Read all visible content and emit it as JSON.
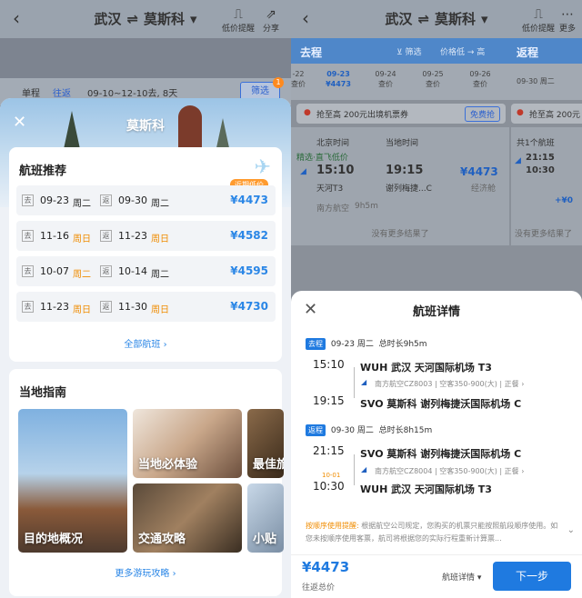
{
  "left": {
    "route": {
      "from": "武汉",
      "arrow": "⇌",
      "to": "莫斯科",
      "dropdown": "▾"
    },
    "actions": [
      {
        "icon": "price-alert-icon",
        "label": "低价提醒"
      },
      {
        "icon": "share-icon",
        "label": "分享"
      }
    ],
    "filter": {
      "one_way": "单程",
      "round_trip": "往返",
      "dates": "09-10~12-10去, 8天",
      "filter_btn": "筛选",
      "badge": "1"
    },
    "sheet": {
      "title": "莫斯科",
      "rec_title": "航班推荐",
      "low_tag": "近期低价",
      "go_tag": "去",
      "ret_tag": "返",
      "flights": [
        {
          "go_date": "09-23",
          "go_wd": "周二",
          "go_we": false,
          "ret_date": "09-30",
          "ret_wd": "周二",
          "ret_we": false,
          "price": "¥4473"
        },
        {
          "go_date": "11-16",
          "go_wd": "周日",
          "go_we": true,
          "ret_date": "11-23",
          "ret_wd": "周日",
          "ret_we": true,
          "price": "¥4582"
        },
        {
          "go_date": "10-07",
          "go_wd": "周二",
          "go_we": true,
          "ret_date": "10-14",
          "ret_wd": "周二",
          "ret_we": false,
          "price": "¥4595"
        },
        {
          "go_date": "11-23",
          "go_wd": "周日",
          "go_we": true,
          "ret_date": "11-30",
          "ret_wd": "周日",
          "ret_we": true,
          "price": "¥4730"
        }
      ],
      "all_flights": "全部航班 ›",
      "guide_title": "当地指南",
      "tiles": [
        "目的地概况",
        "当地必体验",
        "最佳旅",
        "交通攻略",
        "小贴"
      ],
      "more": "更多游玩攻略 ›"
    }
  },
  "right": {
    "route": {
      "from": "武汉",
      "arrow": "⇌",
      "to": "莫斯科",
      "dropdown": "▾"
    },
    "actions": [
      {
        "icon": "price-alert-icon",
        "label": "低价提醒"
      },
      {
        "icon": "more-icon",
        "label": "更多"
      }
    ],
    "tabs": {
      "go": "去程",
      "filter": "筛选",
      "sort": "价格低 → 高",
      "ret": "返程"
    },
    "dates": [
      {
        "date": "-22",
        "sub": "查价"
      },
      {
        "date": "09-23",
        "sub": "¥4473",
        "on": true
      },
      {
        "date": "09-24",
        "sub": "查价"
      },
      {
        "date": "09-25",
        "sub": "查价"
      },
      {
        "date": "09-26",
        "sub": "查价"
      }
    ],
    "ret_date": "09-30 周二",
    "promo": {
      "text": "抢至高 200元出境机票券",
      "btn": "免费抢",
      "text2": "抢至高 200元"
    },
    "list": {
      "col1": "北京时间",
      "col2": "当地时间",
      "tag": "精选·直飞低价",
      "dep": "15:10",
      "arr": "19:15",
      "price": "¥4473",
      "dep_ap": "天河T3",
      "arr_ap": "谢列梅捷...C",
      "cabin": "经济舱",
      "airline": "南方航空",
      "dur": "9h5m",
      "nomore": "没有更多结果了",
      "ret_count": "共1个航班",
      "ret_dep": "21:15",
      "ret_arr": "10:30",
      "ret_price": "+¥0"
    },
    "detail": {
      "title": "航班详情",
      "seg1": {
        "label": "去程",
        "date": "09-23 周二",
        "dur": "总时长9h5m",
        "dep_time": "15:10",
        "dep_ap": "WUH  武汉 天河国际机场 T3",
        "info": "南方航空CZ8003  |  空客350-900(大)  |  正餐 ›",
        "arr_time": "19:15",
        "arr_ap": "SVO  莫斯科 谢列梅捷沃国际机场 C"
      },
      "seg2": {
        "label": "返程",
        "date": "09-30 周二",
        "dur": "总时长8h15m",
        "dep_time": "21:15",
        "dep_ap": "SVO  莫斯科 谢列梅捷沃国际机场 C",
        "info": "南方航空CZ8004  |  空客350-900(大)  |  正餐 ›",
        "plus": "10-01",
        "arr_time": "10:30",
        "arr_ap": "WUH  武汉 天河国际机场 T3"
      },
      "notice_hd": "按顺序使用提醒: ",
      "notice": "根据航空公司规定，您购买的机票只能按照航段顺序使用。如您未按顺序使用客票，航司将根据您的实际行程重新计算票...",
      "total": "¥4473",
      "total_sub": "往返总价",
      "details_link": "航班详情 ▾",
      "next": "下一步"
    }
  }
}
